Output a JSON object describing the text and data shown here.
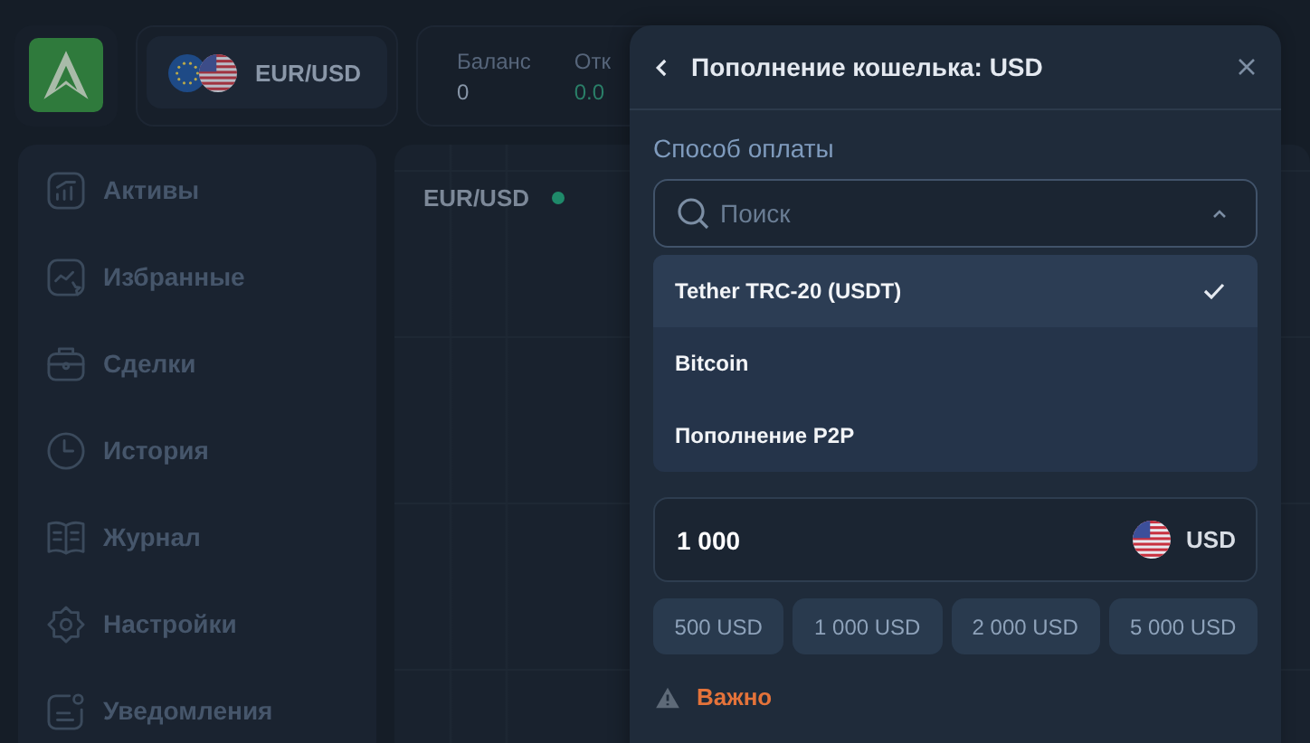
{
  "header": {
    "pair": "EUR/USD",
    "stats": [
      {
        "label": "Баланс",
        "value": "0",
        "kind": "plain"
      },
      {
        "label": "Отк",
        "value": "0.0",
        "kind": "positive"
      }
    ]
  },
  "sidebar": {
    "items": [
      {
        "label": "Активы",
        "kind": "chart"
      },
      {
        "label": "Избранные",
        "kind": "favorites"
      },
      {
        "label": "Сделки",
        "kind": "briefcase"
      },
      {
        "label": "История",
        "kind": "clock"
      },
      {
        "label": "Журнал",
        "kind": "book"
      },
      {
        "label": "Настройки",
        "kind": "gear"
      },
      {
        "label": "Уведомления",
        "kind": "notification"
      }
    ]
  },
  "chart": {
    "pair": "EUR/USD"
  },
  "modal": {
    "title": "Пополнение кошелька: USD",
    "payment_label": "Способ оплаты",
    "search": {
      "placeholder": "Поиск",
      "expanded": true
    },
    "options": [
      {
        "label": "Tether TRC-20 (USDT)",
        "selected": true
      },
      {
        "label": "Bitcoin",
        "selected": false
      },
      {
        "label": "Пополнение P2P",
        "selected": false
      }
    ],
    "amount": {
      "value": "1 000",
      "currency": "USD"
    },
    "presets": [
      "500 USD",
      "1 000 USD",
      "2 000 USD",
      "5 000 USD"
    ],
    "notice": "Важно"
  }
}
